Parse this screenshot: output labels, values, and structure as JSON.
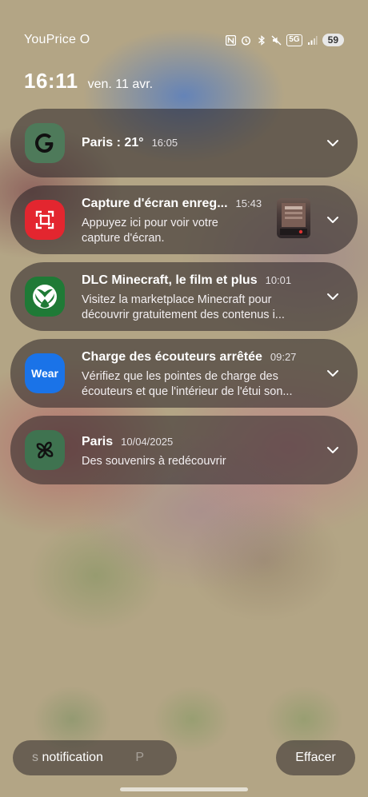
{
  "status_bar": {
    "carrier": "YouPrice O",
    "network": "5G",
    "battery": "59",
    "icons": [
      "nfc-icon",
      "alarm-icon",
      "bluetooth-icon",
      "mute-icon",
      "5g-icon",
      "signal-icon",
      "battery-icon"
    ]
  },
  "header": {
    "time": "16:11",
    "date": "ven. 11 avr."
  },
  "notifications": [
    {
      "app": "google",
      "icon": "google-icon",
      "title": "Paris : 21°",
      "time": "16:05",
      "body": ""
    },
    {
      "app": "screenshot",
      "icon": "screenshot-crop-icon",
      "title": "Capture d'écran enreg...",
      "time": "15:43",
      "body_line1": "Appuyez ici pour voir votre",
      "body_line2": "capture d'écran.",
      "has_thumbnail": true
    },
    {
      "app": "xbox",
      "icon": "xbox-icon",
      "title": "DLC Minecraft, le film et plus",
      "time": "10:01",
      "body_line1": "Visitez la marketplace Minecraft pour",
      "body_line2": "découvrir gratuitement des contenus i..."
    },
    {
      "app": "wear",
      "icon": "wear-icon",
      "icon_text": "Wear",
      "title": "Charge des écouteurs arrêtée",
      "time": "09:27",
      "body_line1": "Vérifiez que les pointes de charge des",
      "body_line2": "écouteurs et que l'intérieur de l'étui son..."
    },
    {
      "app": "photos",
      "icon": "pinwheel-icon",
      "title": "Paris",
      "time": "10/04/2025",
      "body_line1": "Des souvenirs à redécouvrir"
    }
  ],
  "bottom": {
    "settings_prefix": "s",
    "settings_label": "notification",
    "settings_suffix": "P",
    "clear_label": "Effacer"
  },
  "colors": {
    "google_bg": "#4e7a5a",
    "screenshot_bg": "#e3262f",
    "xbox_bg": "#1f7a36",
    "wear_bg": "#1a73e8",
    "photos_bg": "#3f7350"
  }
}
